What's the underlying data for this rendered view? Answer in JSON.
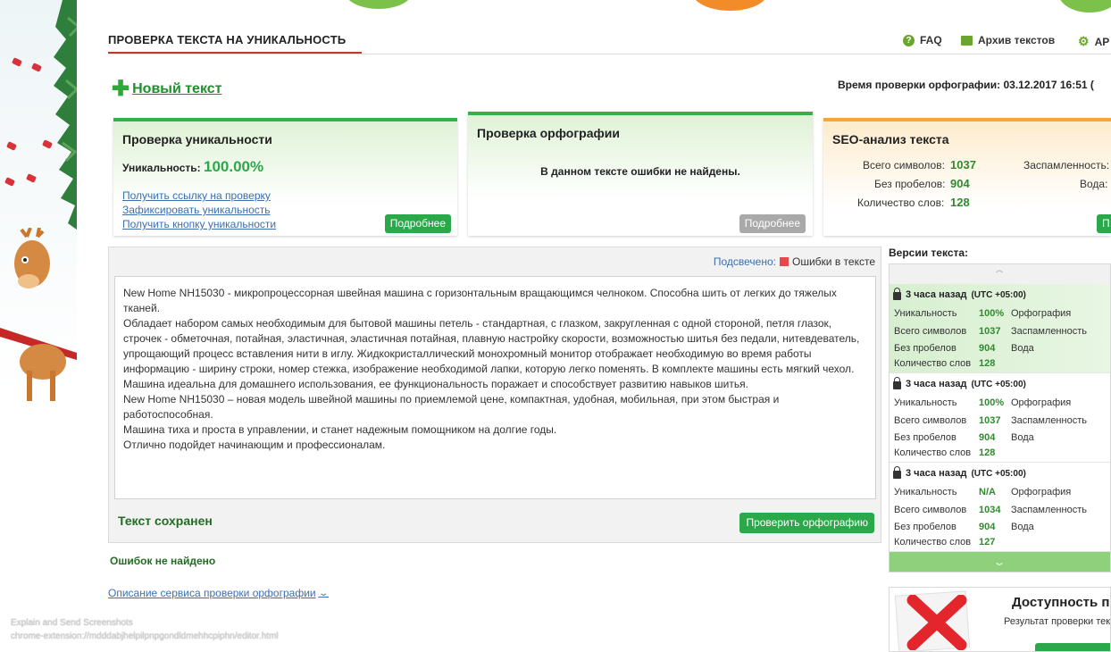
{
  "header": {
    "title": "ПРОВЕРКА ТЕКСТА НА УНИКАЛЬНОСТЬ",
    "nav": [
      {
        "label": "FAQ",
        "icon": "question-icon"
      },
      {
        "label": "Архив текстов",
        "icon": "archive-icon"
      },
      {
        "label": "AP",
        "icon": "gear-icon"
      }
    ]
  },
  "new_text_label": "Новый текст",
  "spell_time": "Время проверки орфографии: 03.12.2017 16:51 (",
  "uniqueness_card": {
    "title": "Проверка уникальности",
    "label": "Уникальность:",
    "value": "100.00%",
    "links": [
      "Получить ссылку на проверку",
      "Зафиксировать уникальность",
      "Получить кнопку уникальности"
    ],
    "button": "Подробнее"
  },
  "spelling_card": {
    "title": "Проверка орфографии",
    "message": "В данном тексте ошибки не найдены.",
    "button": "Подробнее"
  },
  "seo_card": {
    "title": "SEO-анализ текста",
    "rows": [
      {
        "label": "Всего символов:",
        "value": "1037"
      },
      {
        "label": "Без пробелов:",
        "value": "904"
      },
      {
        "label": "Количество слов:",
        "value": "128"
      }
    ],
    "right_labels": [
      "Заспамленность:",
      "Вода:"
    ],
    "button": "П"
  },
  "editor": {
    "highlight_label": "Подсвечено:",
    "highlight_item": "Ошибки в тексте",
    "text": "New Home NH15030 - микропроцессорная швейная машина с горизонтальным вращающимся челноком. Способна шить от легких до тяжелых тканей.\nОбладает набором самых необходимым для бытовой машины петель - стандартная, с глазком, закругленная с одной стороной, петля глазок,\nстрочек - обметочная, потайная, эластичная, эластичная потайная, плавную настройку скорости, возможностью шитья без педали, нитевдеватель,\nупрощающий процесс вставления нити в иглу. Жидкокристаллический монохромный монитор отображает необходимую во время работы\nинформацию - ширину строки, номер стежка, изображение необходимой лапки, которую легко поменять. В комплекте машины есть мягкий чехол.\nМашина идеальна для домашнего использования, ее функциональность поражает и способствует развитию навыков шитья.\nNew Home NH15030 – новая модель швейной машины по приемлемой цене, компактная, удобная, мобильная, при этом быстрая и работоспособная.\nМашина тиха и проста в управлении, и станет надежным помощником на долгие годы.\nОтлично подойдет начинающим и профессионалам.",
    "saved": "Текст сохранен",
    "check_button": "Проверить орфографию"
  },
  "no_errors": "Ошибок не найдено",
  "service_description": "Описание сервиса проверки орфографии",
  "versions": {
    "title": "Версии текста:",
    "labels": {
      "uniq": "Уникальность",
      "total": "Всего символов",
      "nospace": "Без пробелов",
      "words": "Количество слов",
      "spell": "Орфография",
      "spam": "Заспамленность",
      "water": "Вода"
    },
    "items": [
      {
        "time": "3 часа назад",
        "tz": "(UTC +05:00)",
        "uniq": "100%",
        "total": "1037",
        "nospace": "904",
        "words": "128"
      },
      {
        "time": "3 часа назад",
        "tz": "(UTC +05:00)",
        "uniq": "100%",
        "total": "1037",
        "nospace": "904",
        "words": "128"
      },
      {
        "time": "3 часа назад",
        "tz": "(UTC +05:00)",
        "uniq": "N/A",
        "total": "1034",
        "nospace": "904",
        "words": "127"
      }
    ]
  },
  "access": {
    "title": "Доступность п",
    "subtitle": "Результат проверки текс"
  },
  "watermark": {
    "line1": "Explain and Send Screenshots",
    "line2": "chrome-extension://mdddabjhelpilpnpgondldmehhcpiphn/editor.html"
  },
  "colors": {
    "accent_green": "#2aa84a",
    "title_underline": "#c0392b",
    "link_blue": "#3b6fb0",
    "seo_orange": "#f4a63a"
  }
}
